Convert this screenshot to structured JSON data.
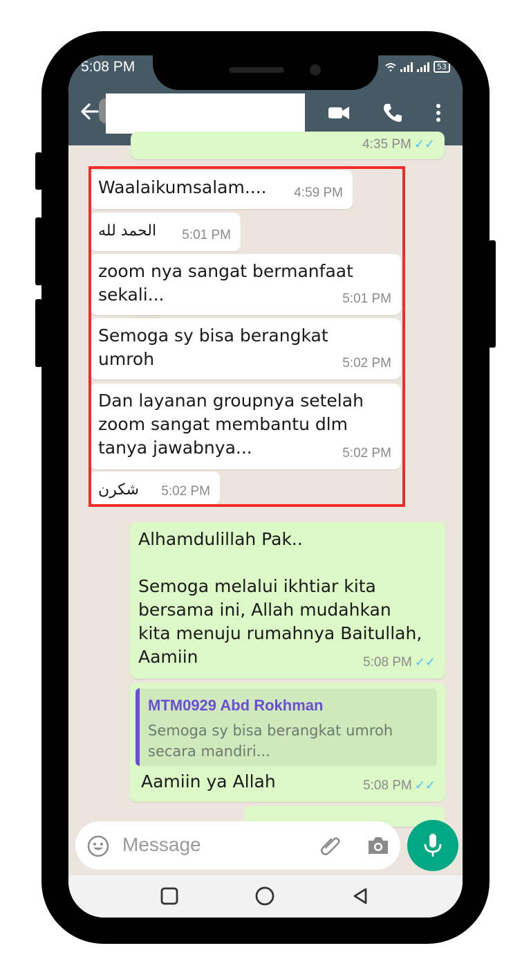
{
  "status_bar": {
    "time": "5:08 PM",
    "battery": "53"
  },
  "header": {
    "contact_name": "",
    "icons": [
      "back-arrow-icon",
      "video-call-icon",
      "voice-call-icon",
      "more-options-icon"
    ]
  },
  "chat": {
    "previous_outgoing_time": "4:35 PM",
    "incoming_messages": [
      {
        "text": "Waalaikumsalam....",
        "time": "4:59 PM"
      },
      {
        "text": "الحمد لله",
        "time": "5:01 PM"
      },
      {
        "text": "zoom nya sangat bermanfaat sekali...",
        "time": "5:01 PM"
      },
      {
        "text": "Semoga sy bisa berangkat umroh",
        "time": "5:02 PM"
      },
      {
        "text": "Dan layanan groupnya setelah zoom sangat membantu dlm tanya jawabnya...",
        "time": "5:02 PM"
      },
      {
        "text": "شكرن",
        "time": "5:02 PM"
      }
    ],
    "outgoing_1": {
      "line1": "Alhamdulillah Pak..",
      "line2": "Semoga melalui ikhtiar kita bersama ini, Allah mudahkan kita menuju rumahnya Baitullah, Aamiin",
      "time": "5:08 PM"
    },
    "outgoing_2": {
      "quote_name": "MTM0929 Abd Rokhman",
      "quote_text": "Semoga sy bisa berangkat umroh secara mandiri...",
      "text": "Aamiin ya Allah",
      "time": "5:08 PM"
    }
  },
  "composer": {
    "placeholder": "Message"
  },
  "colors": {
    "header": "#455a64",
    "outgoing_bubble": "#dcf8c6",
    "chat_bg": "#ece5dd",
    "highlight": "#f02c2c",
    "accent": "#00a884",
    "quote_name": "#6a4fd6"
  }
}
